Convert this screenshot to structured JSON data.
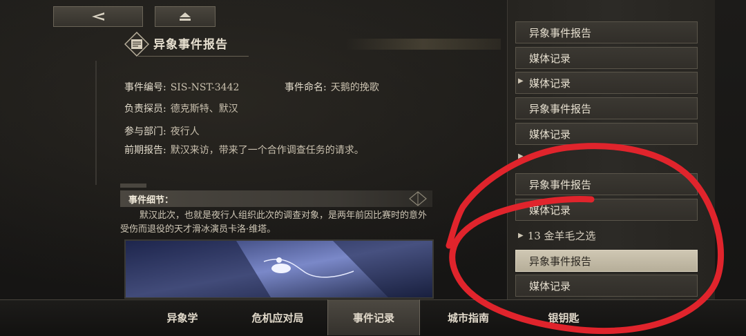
{
  "toolbar": {
    "back_icon": "back-arrow-icon",
    "home_icon": "eject-home-icon"
  },
  "report": {
    "title": "异象事件报告",
    "fields": [
      {
        "label": "事件编号:",
        "value": "SIS-NST-3442"
      },
      {
        "label": "事件命名:",
        "value": "天鹅的挽歌"
      },
      {
        "label": "负责探员:",
        "value": "德克斯特、默汉"
      },
      {
        "label": "参与部门:",
        "value": "夜行人"
      },
      {
        "label": "前期报告:",
        "value": "默汉来访，带来了一个合作调查任务的请求。"
      }
    ],
    "detail_title": "事件细节：",
    "detail_text": "默汉此次，也就是夜行人组织此次的调查对象，是两年前因比赛时的意外受伤而退役的天才滑冰演员卡洛·维塔。"
  },
  "sidebar": {
    "items": [
      {
        "label": "异象事件报告"
      },
      {
        "label": "媒体记录"
      },
      {
        "label": "媒体记录"
      },
      {
        "label": "异象事件报告"
      },
      {
        "label": "媒体记录"
      },
      {
        "label": "异象事件报告"
      },
      {
        "label": "媒体记录"
      },
      {
        "label": "异象事件报告"
      },
      {
        "label": "媒体记录"
      }
    ],
    "chapters": [
      {
        "label": "13 金羊毛之选"
      }
    ]
  },
  "nav": {
    "items": [
      {
        "label": "异象学"
      },
      {
        "label": "危机应对局"
      },
      {
        "label": "事件记录"
      },
      {
        "label": "城市指南"
      },
      {
        "label": "银钥匙"
      }
    ],
    "active": "事件记录"
  },
  "colors": {
    "accent": "#cfc7b3",
    "annotation": "#e0242c"
  }
}
